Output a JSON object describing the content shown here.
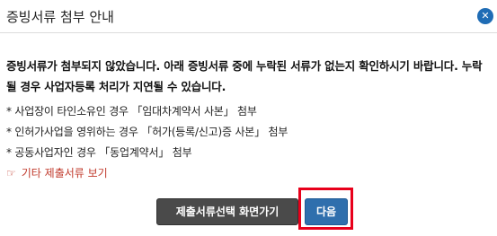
{
  "dialog": {
    "title": "증빙서류 첨부 안내",
    "close_icon": "close-icon"
  },
  "notice": {
    "text": "증빙서류가 첨부되지 않았습니다. 아래 증빙서류 중에 누락된 서류가 없는지 확인하시기 바랍니다. 누락될 경우 사업자등록 처리가 지연될 수 있습니다."
  },
  "items": [
    "* 사업장이 타인소유인 경우 「임대차계약서 사본」 첨부",
    "* 인허가사업을 영위하는 경우 「허가(등록/신고)증 사본」 첨부",
    "* 공동사업자인 경우 「동업계약서」 첨부"
  ],
  "more_link": {
    "icon": "pointing-hand-icon",
    "label": "기타 제출서류 보기"
  },
  "buttons": {
    "select_screen": "제출서류선택 화면가기",
    "next": "다음"
  }
}
